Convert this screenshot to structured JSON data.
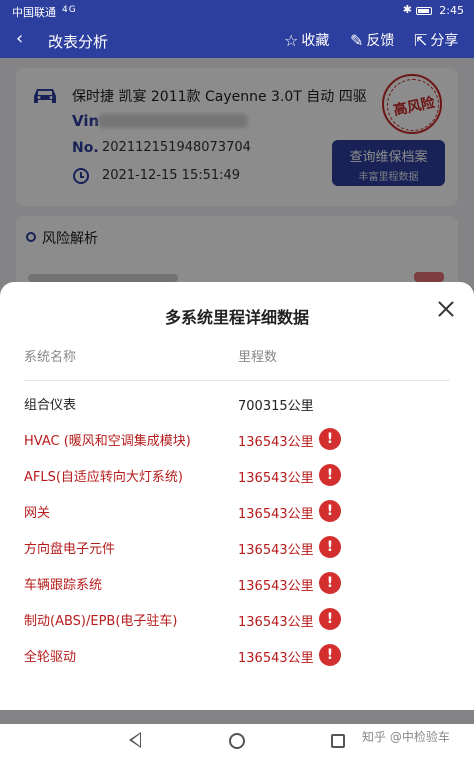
{
  "status_bar": {
    "carrier": "中国联通",
    "signal": "4G",
    "time": "2:45"
  },
  "nav": {
    "title": "改表分析",
    "favorite": "收藏",
    "feedback": "反馈",
    "share": "分享"
  },
  "vehicle": {
    "name": "保时捷 凯宴 2011款 Cayenne 3.0T 自动 四驱",
    "vin_label": "Vin",
    "no_label": "No.",
    "report_no": "202112151948073704",
    "datetime": "2021-12-15 15:51:49",
    "risk_stamp": "高风险",
    "query_button": {
      "line1": "查询维保档案",
      "line2": "丰富里程数据"
    }
  },
  "section": {
    "title": "风险解析"
  },
  "sheet": {
    "title": "多系统里程详细数据",
    "columns": [
      "系统名称",
      "里程数"
    ],
    "rows": [
      {
        "name": "组合仪表",
        "value": "700315公里",
        "warn": false
      },
      {
        "name": "HVAC (暖风和空调集成模块)",
        "value": "136543公里",
        "warn": true
      },
      {
        "name": "AFLS(自适应转向大灯系统)",
        "value": "136543公里",
        "warn": true
      },
      {
        "name": "网关",
        "value": "136543公里",
        "warn": true
      },
      {
        "name": "方向盘电子元件",
        "value": "136543公里",
        "warn": true
      },
      {
        "name": "车辆跟踪系统",
        "value": "136543公里",
        "warn": true
      },
      {
        "name": "制动(ABS)/EPB(电子驻车)",
        "value": "136543公里",
        "warn": true
      },
      {
        "name": "全轮驱动",
        "value": "136543公里",
        "warn": true
      }
    ],
    "alert_glyph": "!"
  },
  "watermark": "知乎 @中检验车",
  "colors": {
    "brand": "#2c3e9e",
    "warning": "#d32f2f"
  }
}
